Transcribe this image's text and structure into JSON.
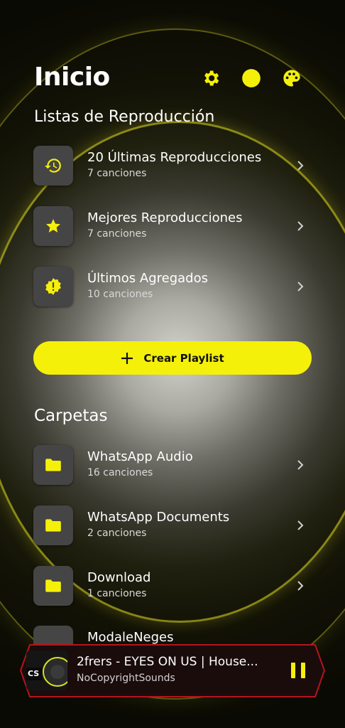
{
  "header": {
    "title": "Inicio",
    "icons": [
      "gear-icon",
      "circle-icon",
      "palette-icon"
    ]
  },
  "playlists": {
    "title": "Listas de Reproducción",
    "items": [
      {
        "name": "20 Últimas Reproducciones",
        "count": "7 canciones",
        "icon": "history-icon"
      },
      {
        "name": "Mejores Reproducciones",
        "count": "7 canciones",
        "icon": "star-icon"
      },
      {
        "name": "Últimos Agregados",
        "count": "10 canciones",
        "icon": "new-badge-icon"
      }
    ],
    "create_label": "Crear Playlist"
  },
  "folders": {
    "title": "Carpetas",
    "items": [
      {
        "name": "WhatsApp Audio",
        "count": "16 canciones",
        "icon": "folder-icon"
      },
      {
        "name": "WhatsApp Documents",
        "count": "2 canciones",
        "icon": "folder-icon"
      },
      {
        "name": "Download",
        "count": "1 canciones",
        "icon": "folder-icon"
      }
    ],
    "partial_item": "ModaleNeges"
  },
  "player": {
    "title": "2frers - EYES ON US | House...",
    "artist": "NoCopyrightSounds",
    "art_text": "CS"
  },
  "colors": {
    "accent": "#f5f00a",
    "tile": "#454545",
    "player_border": "#b5141c"
  }
}
